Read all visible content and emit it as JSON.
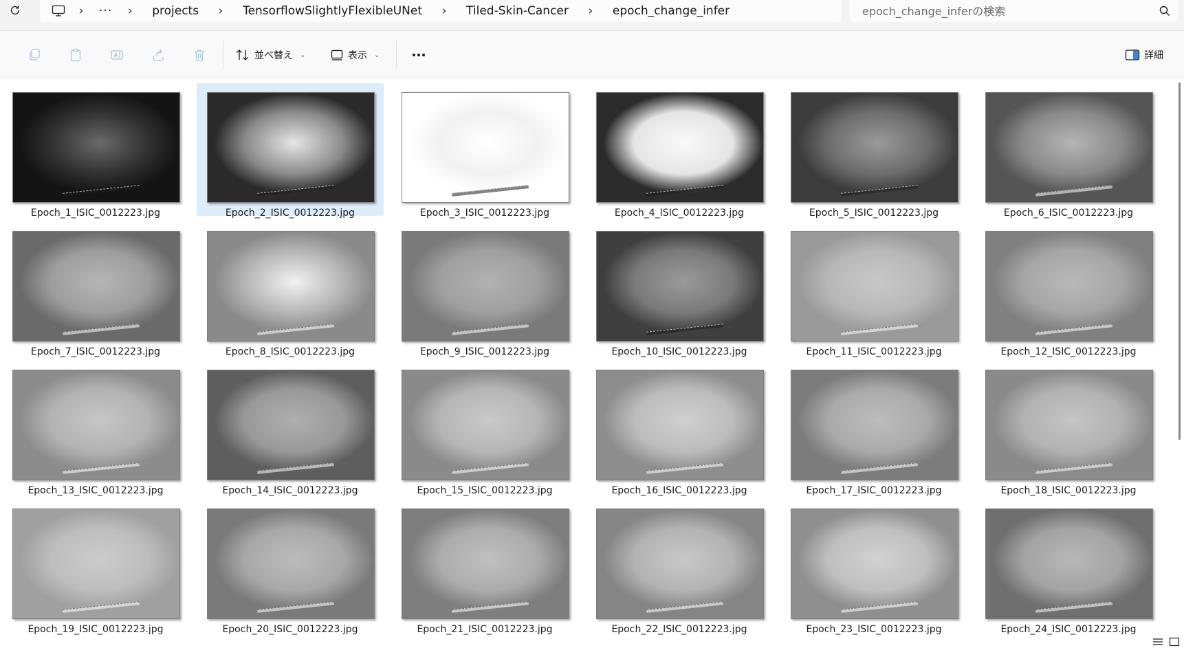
{
  "address_bar": {
    "breadcrumbs": [
      "projects",
      "TensorflowSlightlyFlexibleUNet",
      "Tiled-Skin-Cancer",
      "epoch_change_infer"
    ],
    "overflow_label": "···",
    "search_placeholder": "epoch_change_inferの検索"
  },
  "command_bar": {
    "sort_label": "並べ替え",
    "view_label": "表示",
    "details_label": "詳細"
  },
  "files": [
    {
      "name": "Epoch_1_ISIC_0012223.jpg",
      "selected": false
    },
    {
      "name": "Epoch_2_ISIC_0012223.jpg",
      "selected": true
    },
    {
      "name": "Epoch_3_ISIC_0012223.jpg",
      "selected": false
    },
    {
      "name": "Epoch_4_ISIC_0012223.jpg",
      "selected": false
    },
    {
      "name": "Epoch_5_ISIC_0012223.jpg",
      "selected": false
    },
    {
      "name": "Epoch_6_ISIC_0012223.jpg",
      "selected": false
    },
    {
      "name": "Epoch_7_ISIC_0012223.jpg",
      "selected": false
    },
    {
      "name": "Epoch_8_ISIC_0012223.jpg",
      "selected": false
    },
    {
      "name": "Epoch_9_ISIC_0012223.jpg",
      "selected": false
    },
    {
      "name": "Epoch_10_ISIC_0012223.jpg",
      "selected": false
    },
    {
      "name": "Epoch_11_ISIC_0012223.jpg",
      "selected": false
    },
    {
      "name": "Epoch_12_ISIC_0012223.jpg",
      "selected": false
    },
    {
      "name": "Epoch_13_ISIC_0012223.jpg",
      "selected": false
    },
    {
      "name": "Epoch_14_ISIC_0012223.jpg",
      "selected": false
    },
    {
      "name": "Epoch_15_ISIC_0012223.jpg",
      "selected": false
    },
    {
      "name": "Epoch_16_ISIC_0012223.jpg",
      "selected": false
    },
    {
      "name": "Epoch_17_ISIC_0012223.jpg",
      "selected": false
    },
    {
      "name": "Epoch_18_ISIC_0012223.jpg",
      "selected": false
    },
    {
      "name": "Epoch_19_ISIC_0012223.jpg",
      "selected": false
    },
    {
      "name": "Epoch_20_ISIC_0012223.jpg",
      "selected": false
    },
    {
      "name": "Epoch_21_ISIC_0012223.jpg",
      "selected": false
    },
    {
      "name": "Epoch_22_ISIC_0012223.jpg",
      "selected": false
    },
    {
      "name": "Epoch_23_ISIC_0012223.jpg",
      "selected": false
    },
    {
      "name": "Epoch_24_ISIC_0012223.jpg",
      "selected": false
    }
  ],
  "colors": {
    "selection": "#dbecfb",
    "accent": "#005fb8"
  }
}
